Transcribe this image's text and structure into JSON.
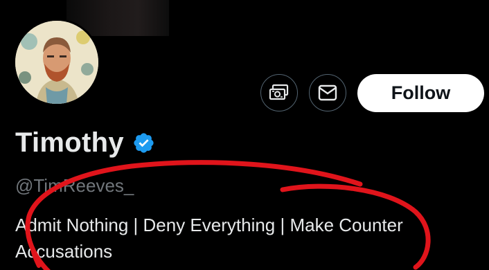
{
  "profile": {
    "display_name": "Timothy",
    "handle": "@TimReeves_",
    "bio": "Admit Nothing | Deny Everything | Make Counter Accusations",
    "verified": true
  },
  "actions": {
    "tip_icon": "money-tip-icon",
    "message_icon": "envelope-icon",
    "follow_label": "Follow"
  },
  "colors": {
    "background": "#000000",
    "primary_text": "#e7e9ea",
    "secondary_text": "#71767b",
    "verified_badge": "#1d9bf0",
    "button_border": "#536471",
    "follow_bg": "#ffffff",
    "annotation": "#e0141b"
  }
}
